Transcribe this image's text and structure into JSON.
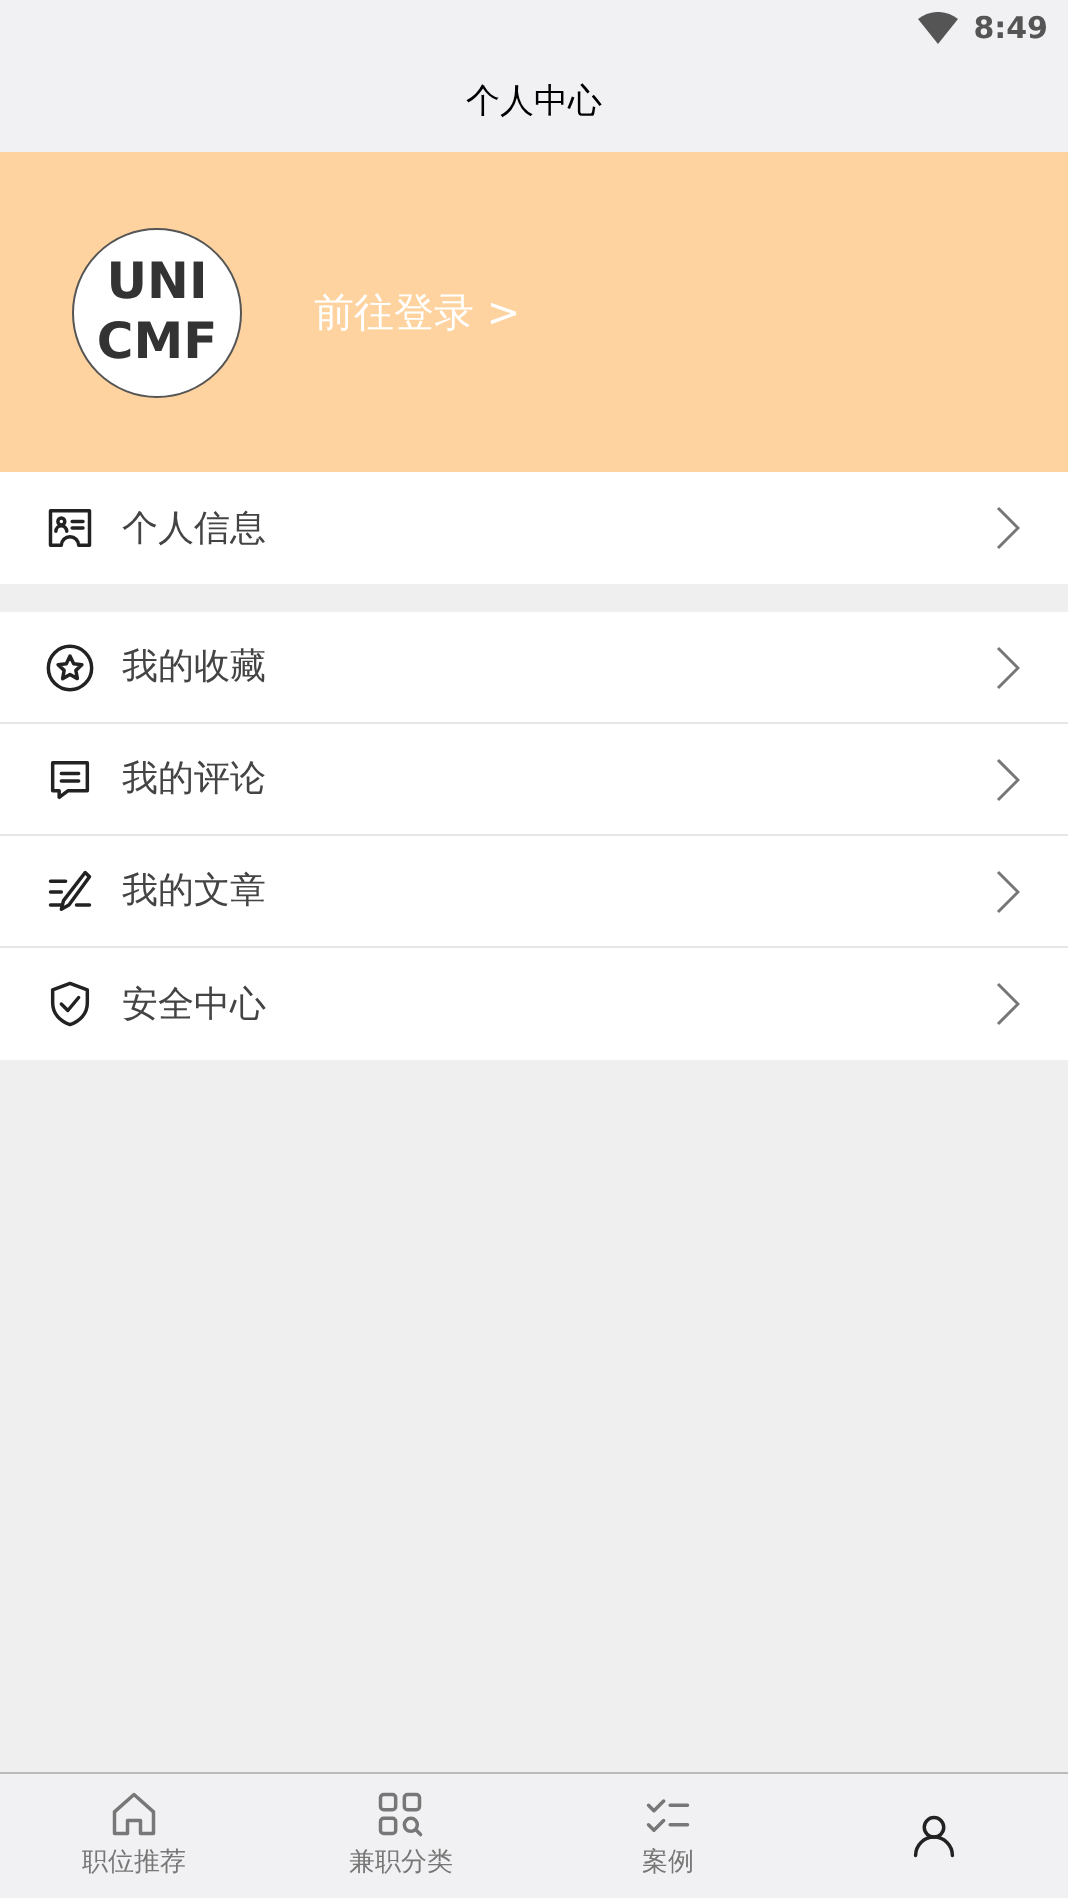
{
  "status_bar": {
    "time": "8:49"
  },
  "header": {
    "title": "个人中心"
  },
  "profile": {
    "avatar_lines": [
      "UNI",
      "CMF"
    ],
    "login_link": "前往登录 >"
  },
  "menu_groups": [
    {
      "items": [
        {
          "label": "个人信息"
        }
      ]
    },
    {
      "items": [
        {
          "label": "我的收藏"
        },
        {
          "label": "我的评论"
        },
        {
          "label": "我的文章"
        },
        {
          "label": "安全中心"
        }
      ]
    }
  ],
  "tab_bar": [
    {
      "label": "职位推荐",
      "selected": false
    },
    {
      "label": "兼职分类",
      "selected": false
    },
    {
      "label": "案例",
      "selected": false
    },
    {
      "selected": true
    }
  ]
}
